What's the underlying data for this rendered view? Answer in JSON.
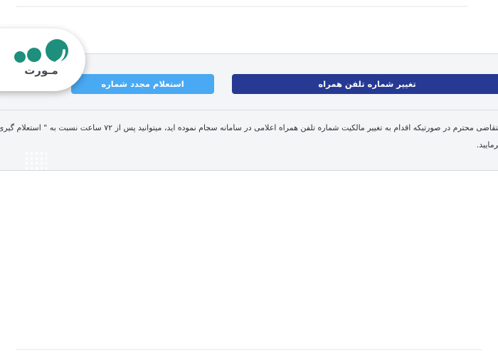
{
  "buttons": {
    "change_number": "تغییر شماره تلفن همراه",
    "reinquiry": "استعلام مجدد شماره"
  },
  "notice": {
    "line1": "متقاضی محترم در صورتیکه اقدام به تغییر مالکیت شماره تلفن همراه اعلامی در سامانه سجام نموده اید، میتوانید پس از ۷۲ ساعت نسبت به \" استعلام گیری مجدد",
    "line2": "فرمایید."
  },
  "logo": {
    "text": "مـورت",
    "dot_color": "#1e8f7c"
  },
  "colors": {
    "primary_button": "#263a94",
    "secondary_button": "#4aa9f3",
    "panel_background": "#f4f5f7"
  }
}
